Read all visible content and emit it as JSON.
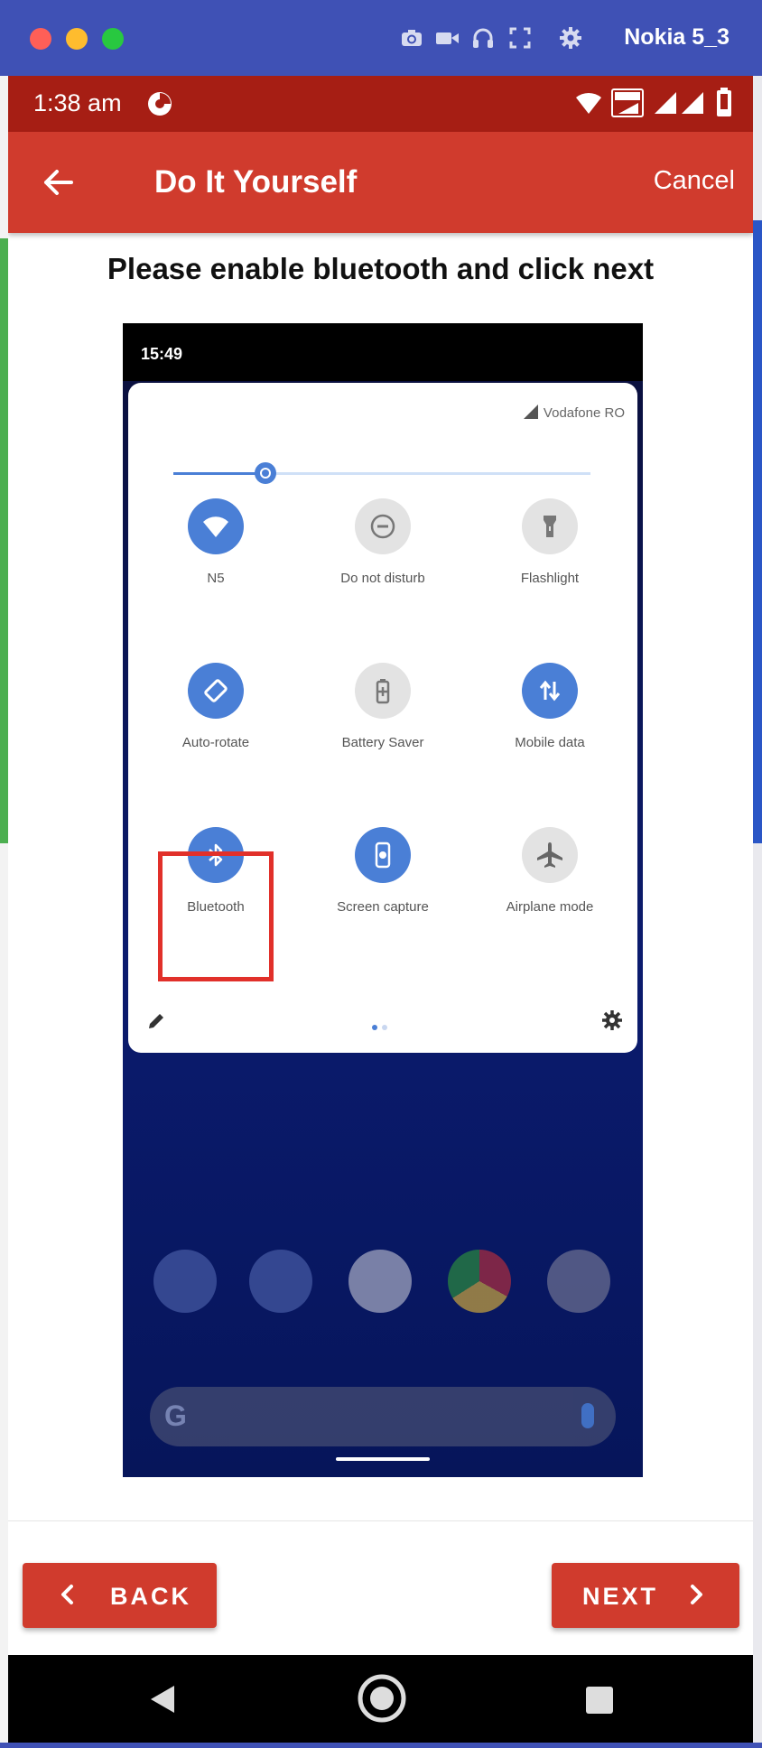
{
  "window": {
    "device_name": "Nokia 5_3",
    "toolbar_icons": [
      "camera-icon",
      "video-icon",
      "headphones-icon",
      "fullscreen-icon",
      "gear-icon"
    ]
  },
  "status_bar": {
    "time": "1:38 am",
    "icons": [
      "app-notification-icon",
      "wifi-icon",
      "volte-icon",
      "signal-icon",
      "signal-icon",
      "battery-icon"
    ]
  },
  "app_bar": {
    "title": "Do It Yourself",
    "cancel_label": "Cancel",
    "back_icon": "arrow-left-icon"
  },
  "instruction": "Please enable bluetooth and click next",
  "guide_image": {
    "time": "15:49",
    "carrier": "Vodafone RO",
    "brightness_level": 0.22,
    "tiles": [
      {
        "label": "N5",
        "icon": "wifi-icon",
        "active": true
      },
      {
        "label": "Do not disturb",
        "icon": "do-not-disturb-icon",
        "active": false
      },
      {
        "label": "Flashlight",
        "icon": "flashlight-icon",
        "active": false
      },
      {
        "label": "Auto-rotate",
        "icon": "auto-rotate-icon",
        "active": true
      },
      {
        "label": "Battery Saver",
        "icon": "battery-saver-icon",
        "active": false
      },
      {
        "label": "Mobile data",
        "icon": "mobile-data-icon",
        "active": true
      },
      {
        "label": "Bluetooth",
        "icon": "bluetooth-icon",
        "active": true
      },
      {
        "label": "Screen capture",
        "icon": "screen-capture-icon",
        "active": true
      },
      {
        "label": "Airplane mode",
        "icon": "airplane-icon",
        "active": false
      }
    ],
    "highlighted_tile": "Bluetooth",
    "dock_apps": [
      "phone-icon",
      "messages-icon",
      "play-store-icon",
      "chrome-icon",
      "camera-icon"
    ],
    "search_logo": "G"
  },
  "buttons": {
    "back_label": "BACK",
    "next_label": "NEXT"
  },
  "nav_bar": [
    "nav-back-icon",
    "nav-home-icon",
    "nav-recents-icon"
  ],
  "colors": {
    "window_chrome": "#3f51b5",
    "status_bar": "#a61e14",
    "app_bar": "#d03b2d",
    "highlight": "#e1302a",
    "tile_active": "#4a7fd6"
  }
}
